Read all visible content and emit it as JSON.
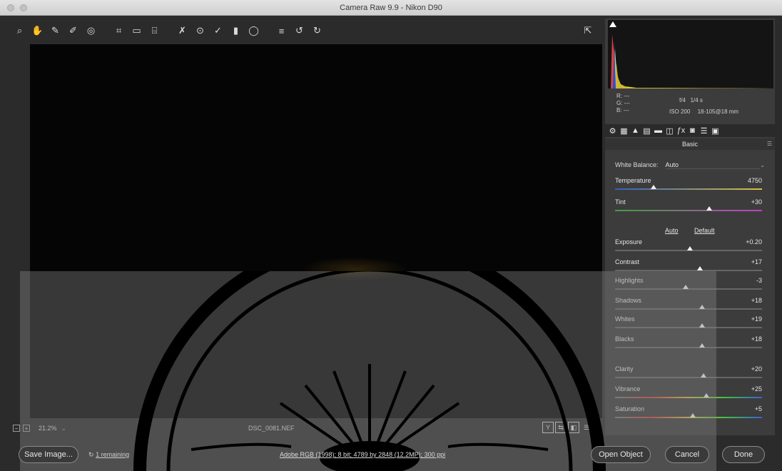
{
  "window": {
    "title": "Camera Raw 9.9  -  Nikon D90"
  },
  "toolbar": {
    "tools": [
      {
        "name": "zoom-icon",
        "glyph": "⌕"
      },
      {
        "name": "hand-icon",
        "glyph": "✋"
      },
      {
        "name": "white-balance-icon",
        "glyph": "✎"
      },
      {
        "name": "color-sampler-icon",
        "glyph": "✐"
      },
      {
        "name": "targeted-adjustment-icon",
        "glyph": "◎"
      },
      {
        "name": "crop-icon",
        "glyph": "⌗"
      },
      {
        "name": "straighten-icon",
        "glyph": "▭"
      },
      {
        "name": "transform-icon",
        "glyph": "⌸"
      },
      {
        "name": "spot-removal-icon",
        "glyph": "✗"
      },
      {
        "name": "red-eye-icon",
        "glyph": "⊙"
      },
      {
        "name": "adjustment-brush-icon",
        "glyph": "✓"
      },
      {
        "name": "graduated-filter-icon",
        "glyph": "▮"
      },
      {
        "name": "radial-filter-icon",
        "glyph": "◯"
      },
      {
        "name": "preferences-icon",
        "glyph": "≡"
      },
      {
        "name": "rotate-left-icon",
        "glyph": "↺"
      },
      {
        "name": "rotate-right-icon",
        "glyph": "↻"
      }
    ],
    "open_prefs_icon": "⇱"
  },
  "histogram": {
    "rgb_lines": [
      "R:  ---",
      "G:  ---",
      "B:  ---"
    ],
    "aperture": "f/4",
    "shutter": "1/4 s",
    "iso": "ISO 200",
    "lens": "18-105@18 mm"
  },
  "panel_tabs": [
    "⚙",
    "▦",
    "▲",
    "▤",
    "▬",
    "◫",
    "ƒx",
    "◙",
    "☰",
    "▣"
  ],
  "panel": {
    "title": "Basic",
    "menu_icon": "☰",
    "white_balance_label": "White Balance:",
    "white_balance_value": "Auto",
    "auto_label": "Auto",
    "default_label": "Default",
    "sliders": [
      {
        "label": "Temperature",
        "value": "4750",
        "level": 0.26
      },
      {
        "label": "Tint",
        "value": "+30",
        "level": 0.64
      },
      {
        "label": "Exposure",
        "value": "+0.20",
        "level": 0.51
      },
      {
        "label": "Contrast",
        "value": "+17",
        "level": 0.58
      },
      {
        "label": "Highlights",
        "value": "-3",
        "level": 0.48
      },
      {
        "label": "Shadows",
        "value": "+18",
        "level": 0.59
      },
      {
        "label": "Whites",
        "value": "+19",
        "level": 0.59
      },
      {
        "label": "Blacks",
        "value": "+18",
        "level": 0.59
      },
      {
        "label": "Clarity",
        "value": "+20",
        "level": 0.6
      },
      {
        "label": "Vibrance",
        "value": "+25",
        "level": 0.62
      },
      {
        "label": "Saturation",
        "value": "+5",
        "level": 0.53
      }
    ]
  },
  "status": {
    "zoom": "21.2%",
    "filename": "DSC_0081.NEF",
    "view_buttons": [
      "Y",
      "⇆",
      "◧",
      "☰"
    ]
  },
  "bottom": {
    "save_image": "Save Image...",
    "remaining_icon": "↻",
    "remaining": "1 remaining",
    "workflow": "Adobe RGB (1998); 8 bit; 4789 by 2848 (12.2MP); 300 ppi",
    "open_object": "Open Object",
    "cancel": "Cancel",
    "done": "Done"
  }
}
